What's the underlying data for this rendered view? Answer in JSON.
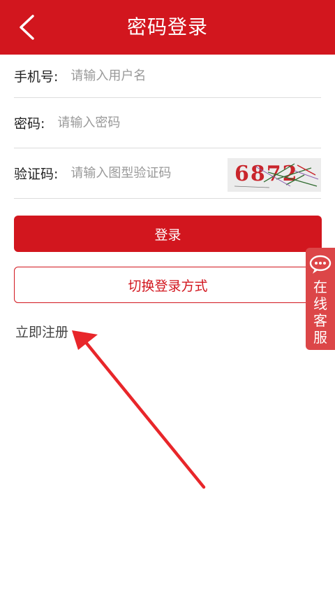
{
  "header": {
    "title": "密码登录",
    "back_icon": "chevron-left-icon",
    "color": "#d2161e"
  },
  "form": {
    "phone": {
      "label": "手机号:",
      "placeholder": "请输入用户名"
    },
    "password": {
      "label": "密码:",
      "placeholder": "请输入密码"
    },
    "captcha": {
      "label": "验证码:",
      "placeholder": "请输入图型验证码",
      "code": "6872"
    }
  },
  "buttons": {
    "login": "登录",
    "switch": "切换登录方式"
  },
  "register_link": "立即注册",
  "service": {
    "icon": "chat-bubble-icon",
    "label": "在线客服",
    "color": "#dc4648"
  }
}
